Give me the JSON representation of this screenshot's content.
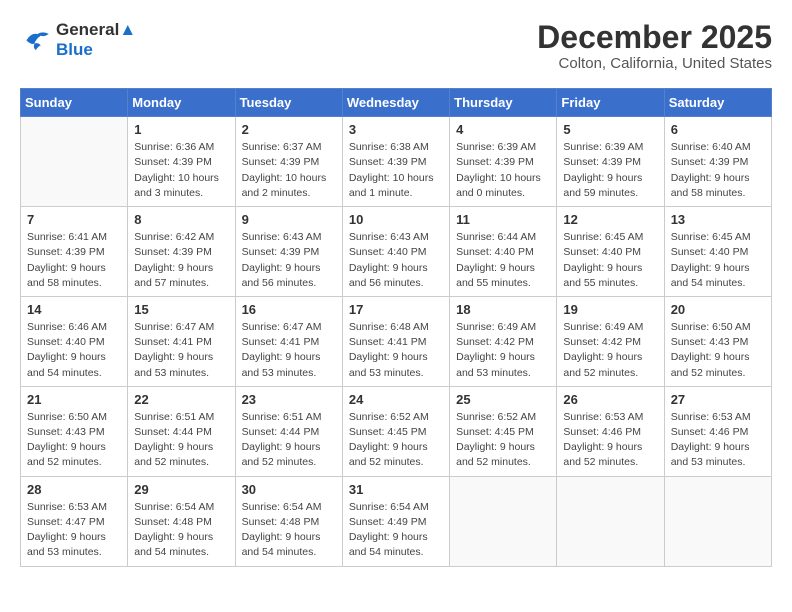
{
  "header": {
    "logo_line1": "General",
    "logo_line2": "Blue",
    "month": "December 2025",
    "location": "Colton, California, United States"
  },
  "weekdays": [
    "Sunday",
    "Monday",
    "Tuesday",
    "Wednesday",
    "Thursday",
    "Friday",
    "Saturday"
  ],
  "weeks": [
    [
      {
        "day": "",
        "info": ""
      },
      {
        "day": "1",
        "info": "Sunrise: 6:36 AM\nSunset: 4:39 PM\nDaylight: 10 hours\nand 3 minutes."
      },
      {
        "day": "2",
        "info": "Sunrise: 6:37 AM\nSunset: 4:39 PM\nDaylight: 10 hours\nand 2 minutes."
      },
      {
        "day": "3",
        "info": "Sunrise: 6:38 AM\nSunset: 4:39 PM\nDaylight: 10 hours\nand 1 minute."
      },
      {
        "day": "4",
        "info": "Sunrise: 6:39 AM\nSunset: 4:39 PM\nDaylight: 10 hours\nand 0 minutes."
      },
      {
        "day": "5",
        "info": "Sunrise: 6:39 AM\nSunset: 4:39 PM\nDaylight: 9 hours\nand 59 minutes."
      },
      {
        "day": "6",
        "info": "Sunrise: 6:40 AM\nSunset: 4:39 PM\nDaylight: 9 hours\nand 58 minutes."
      }
    ],
    [
      {
        "day": "7",
        "info": "Sunrise: 6:41 AM\nSunset: 4:39 PM\nDaylight: 9 hours\nand 58 minutes."
      },
      {
        "day": "8",
        "info": "Sunrise: 6:42 AM\nSunset: 4:39 PM\nDaylight: 9 hours\nand 57 minutes."
      },
      {
        "day": "9",
        "info": "Sunrise: 6:43 AM\nSunset: 4:39 PM\nDaylight: 9 hours\nand 56 minutes."
      },
      {
        "day": "10",
        "info": "Sunrise: 6:43 AM\nSunset: 4:40 PM\nDaylight: 9 hours\nand 56 minutes."
      },
      {
        "day": "11",
        "info": "Sunrise: 6:44 AM\nSunset: 4:40 PM\nDaylight: 9 hours\nand 55 minutes."
      },
      {
        "day": "12",
        "info": "Sunrise: 6:45 AM\nSunset: 4:40 PM\nDaylight: 9 hours\nand 55 minutes."
      },
      {
        "day": "13",
        "info": "Sunrise: 6:45 AM\nSunset: 4:40 PM\nDaylight: 9 hours\nand 54 minutes."
      }
    ],
    [
      {
        "day": "14",
        "info": "Sunrise: 6:46 AM\nSunset: 4:40 PM\nDaylight: 9 hours\nand 54 minutes."
      },
      {
        "day": "15",
        "info": "Sunrise: 6:47 AM\nSunset: 4:41 PM\nDaylight: 9 hours\nand 53 minutes."
      },
      {
        "day": "16",
        "info": "Sunrise: 6:47 AM\nSunset: 4:41 PM\nDaylight: 9 hours\nand 53 minutes."
      },
      {
        "day": "17",
        "info": "Sunrise: 6:48 AM\nSunset: 4:41 PM\nDaylight: 9 hours\nand 53 minutes."
      },
      {
        "day": "18",
        "info": "Sunrise: 6:49 AM\nSunset: 4:42 PM\nDaylight: 9 hours\nand 53 minutes."
      },
      {
        "day": "19",
        "info": "Sunrise: 6:49 AM\nSunset: 4:42 PM\nDaylight: 9 hours\nand 52 minutes."
      },
      {
        "day": "20",
        "info": "Sunrise: 6:50 AM\nSunset: 4:43 PM\nDaylight: 9 hours\nand 52 minutes."
      }
    ],
    [
      {
        "day": "21",
        "info": "Sunrise: 6:50 AM\nSunset: 4:43 PM\nDaylight: 9 hours\nand 52 minutes."
      },
      {
        "day": "22",
        "info": "Sunrise: 6:51 AM\nSunset: 4:44 PM\nDaylight: 9 hours\nand 52 minutes."
      },
      {
        "day": "23",
        "info": "Sunrise: 6:51 AM\nSunset: 4:44 PM\nDaylight: 9 hours\nand 52 minutes."
      },
      {
        "day": "24",
        "info": "Sunrise: 6:52 AM\nSunset: 4:45 PM\nDaylight: 9 hours\nand 52 minutes."
      },
      {
        "day": "25",
        "info": "Sunrise: 6:52 AM\nSunset: 4:45 PM\nDaylight: 9 hours\nand 52 minutes."
      },
      {
        "day": "26",
        "info": "Sunrise: 6:53 AM\nSunset: 4:46 PM\nDaylight: 9 hours\nand 52 minutes."
      },
      {
        "day": "27",
        "info": "Sunrise: 6:53 AM\nSunset: 4:46 PM\nDaylight: 9 hours\nand 53 minutes."
      }
    ],
    [
      {
        "day": "28",
        "info": "Sunrise: 6:53 AM\nSunset: 4:47 PM\nDaylight: 9 hours\nand 53 minutes."
      },
      {
        "day": "29",
        "info": "Sunrise: 6:54 AM\nSunset: 4:48 PM\nDaylight: 9 hours\nand 54 minutes."
      },
      {
        "day": "30",
        "info": "Sunrise: 6:54 AM\nSunset: 4:48 PM\nDaylight: 9 hours\nand 54 minutes."
      },
      {
        "day": "31",
        "info": "Sunrise: 6:54 AM\nSunset: 4:49 PM\nDaylight: 9 hours\nand 54 minutes."
      },
      {
        "day": "",
        "info": ""
      },
      {
        "day": "",
        "info": ""
      },
      {
        "day": "",
        "info": ""
      }
    ]
  ]
}
